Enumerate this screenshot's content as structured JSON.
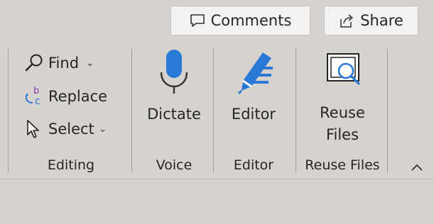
{
  "topbar": {
    "comments_label": "Comments",
    "share_label": "Share"
  },
  "editing": {
    "find_label": "Find",
    "replace_label": "Replace",
    "select_label": "Select",
    "group_label": "Editing"
  },
  "voice": {
    "dictate_label": "Dictate",
    "group_label": "Voice"
  },
  "editor": {
    "editor_label": "Editor",
    "group_label": "Editor"
  },
  "reuse": {
    "button_label_line1": "Reuse",
    "button_label_line2": "Files",
    "group_label": "Reuse Files"
  },
  "icons": {
    "comments": "comment-icon",
    "share": "share-icon",
    "find": "search-icon",
    "replace": "replace-icon",
    "select": "cursor-icon",
    "dictate": "microphone-icon",
    "editor": "pen-icon",
    "reuse": "reuse-files-icon",
    "collapse": "chevron-up-icon"
  },
  "colors": {
    "background": "#d6d3ce",
    "accent_blue": "#2b79d6",
    "replace_purple": "#8a3ab9"
  }
}
